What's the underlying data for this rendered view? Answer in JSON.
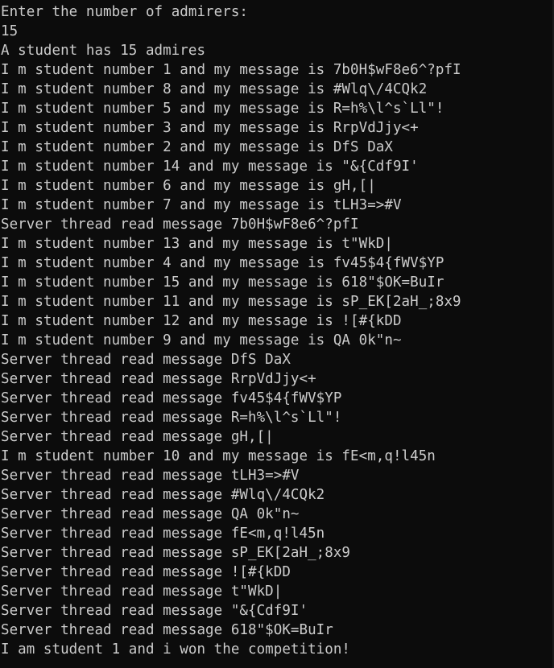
{
  "console": {
    "lines": [
      "Enter the number of admirers:",
      "15",
      "A student has 15 admires",
      "I m student number 1 and my message is 7b0H$wF8e6^?pfI",
      "I m student number 8 and my message is #Wlq\\/4CQk2",
      "I m student number 5 and my message is R=h%\\l^s`Ll\"!",
      "I m student number 3 and my message is RrpVdJjy<+",
      "I m student number 2 and my message is DfS DaX",
      "I m student number 14 and my message is \"&{Cdf9I'",
      "I m student number 6 and my message is gH,[|",
      "I m student number 7 and my message is tLH3=>#V",
      "Server thread read message 7b0H$wF8e6^?pfI",
      "I m student number 13 and my message is t\"WkD|",
      "I m student number 4 and my message is fv45$4{fWV$YP",
      "I m student number 15 and my message is 618\"$OK=BuIr",
      "I m student number 11 and my message is sP_EK[2aH_;8x9",
      "I m student number 12 and my message is ![#{kDD",
      "I m student number 9 and my message is QA 0k\"n~",
      "Server thread read message DfS DaX",
      "Server thread read message RrpVdJjy<+",
      "Server thread read message fv45$4{fWV$YP",
      "Server thread read message R=h%\\l^s`Ll\"!",
      "Server thread read message gH,[|",
      "I m student number 10 and my message is fE<m,q!l45n",
      "Server thread read message tLH3=>#V",
      "Server thread read message #Wlq\\/4CQk2",
      "Server thread read message QA 0k\"n~",
      "Server thread read message fE<m,q!l45n",
      "Server thread read message sP_EK[2aH_;8x9",
      "Server thread read message ![#{kDD",
      "Server thread read message t\"WkD|",
      "Server thread read message \"&{Cdf9I'",
      "Server thread read message 618\"$OK=BuIr",
      "I am student 1 and i won the competition!"
    ]
  },
  "colors": {
    "background": "#0c0c0c",
    "text": "#cccccc"
  }
}
